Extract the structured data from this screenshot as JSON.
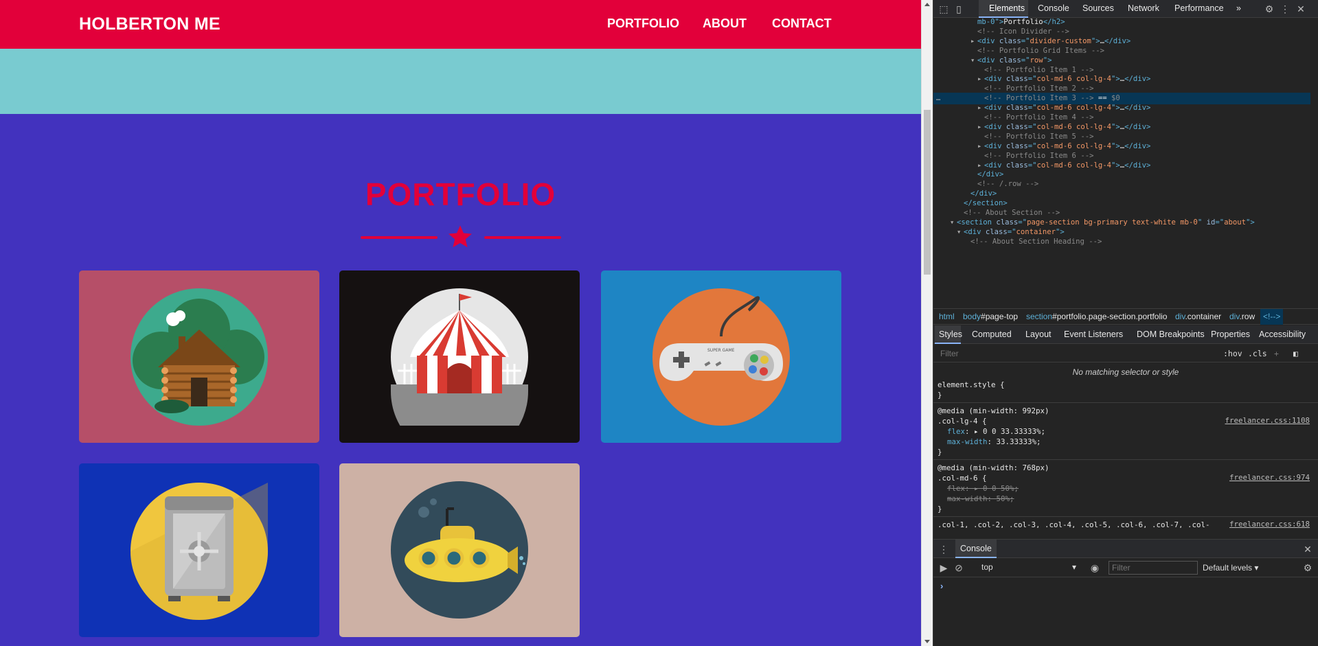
{
  "site": {
    "brand": "HOLBERTON ME",
    "nav": [
      "PORTFOLIO",
      "ABOUT",
      "CONTACT"
    ],
    "portfolio_heading": "PORTFOLIO",
    "colors": {
      "navbar": "#e2003a",
      "teal_band": "#79cbd0",
      "section_bg": "#4232be",
      "heading": "#e2003a"
    },
    "cards": [
      {
        "icon": "cabin-icon",
        "bg": "#b64f68"
      },
      {
        "icon": "circus-tent-icon",
        "bg": "#151111"
      },
      {
        "icon": "game-controller-icon",
        "bg": "#1e85c4"
      },
      {
        "icon": "safe-icon",
        "bg": "#0f32b5"
      },
      {
        "icon": "submarine-icon",
        "bg": "#cdb1a5"
      }
    ],
    "controller_label": "SUPER GAME"
  },
  "devtools": {
    "tabs": [
      "Elements",
      "Console",
      "Sources",
      "Network",
      "Performance"
    ],
    "more_tabs": "»",
    "dom_lines": [
      {
        "parts": [
          [
            "t",
            "mb-0\">"
          ],
          [
            "x",
            "Portfolio"
          ],
          [
            "t",
            "</h2>"
          ]
        ]
      },
      {
        "parts": [
          [
            "c",
            "<!-- Icon Divider -->"
          ]
        ]
      },
      {
        "parts": [
          [
            "t",
            "<div "
          ],
          [
            "a",
            "class"
          ],
          [
            "t",
            "=\""
          ],
          [
            "v",
            "divider-custom"
          ],
          [
            "t",
            "\">"
          ],
          [
            "x",
            "…"
          ],
          [
            "t",
            "</div>"
          ]
        ]
      },
      {
        "parts": [
          [
            "c",
            "<!-- Portfolio Grid Items -->"
          ]
        ]
      },
      {
        "parts": [
          [
            "t",
            "<div "
          ],
          [
            "a",
            "class"
          ],
          [
            "t",
            "=\""
          ],
          [
            "v",
            "row"
          ],
          [
            "t",
            "\">"
          ]
        ]
      },
      {
        "parts": [
          [
            "c",
            "<!-- Portfolio Item 1 -->"
          ]
        ]
      },
      {
        "parts": [
          [
            "t",
            "<div "
          ],
          [
            "a",
            "class"
          ],
          [
            "t",
            "=\""
          ],
          [
            "v",
            "col-md-6 col-lg-4"
          ],
          [
            "t",
            "\">"
          ],
          [
            "x",
            "…"
          ],
          [
            "t",
            "</div>"
          ]
        ]
      },
      {
        "parts": [
          [
            "c",
            "<!-- Portfolio Item 2 -->"
          ]
        ]
      },
      {
        "parts": [
          [
            "c",
            "<!-- Portfolio Item 3 -->"
          ],
          [
            "x",
            " == "
          ],
          [
            "c",
            "$0"
          ]
        ]
      },
      {
        "parts": [
          [
            "t",
            "<div "
          ],
          [
            "a",
            "class"
          ],
          [
            "t",
            "=\""
          ],
          [
            "v",
            "col-md-6 col-lg-4"
          ],
          [
            "t",
            "\">"
          ],
          [
            "x",
            "…"
          ],
          [
            "t",
            "</div>"
          ]
        ]
      },
      {
        "parts": [
          [
            "c",
            "<!-- Portfolio Item 4 -->"
          ]
        ]
      },
      {
        "parts": [
          [
            "t",
            "<div "
          ],
          [
            "a",
            "class"
          ],
          [
            "t",
            "=\""
          ],
          [
            "v",
            "col-md-6 col-lg-4"
          ],
          [
            "t",
            "\">"
          ],
          [
            "x",
            "…"
          ],
          [
            "t",
            "</div>"
          ]
        ]
      },
      {
        "parts": [
          [
            "c",
            "<!-- Portfolio Item 5 -->"
          ]
        ]
      },
      {
        "parts": [
          [
            "t",
            "<div "
          ],
          [
            "a",
            "class"
          ],
          [
            "t",
            "=\""
          ],
          [
            "v",
            "col-md-6 col-lg-4"
          ],
          [
            "t",
            "\">"
          ],
          [
            "x",
            "…"
          ],
          [
            "t",
            "</div>"
          ]
        ]
      },
      {
        "parts": [
          [
            "c",
            "<!-- Portfolio Item 6 -->"
          ]
        ]
      },
      {
        "parts": [
          [
            "t",
            "<div "
          ],
          [
            "a",
            "class"
          ],
          [
            "t",
            "=\""
          ],
          [
            "v",
            "col-md-6 col-lg-4"
          ],
          [
            "t",
            "\">"
          ],
          [
            "x",
            "…"
          ],
          [
            "t",
            "</div>"
          ]
        ]
      },
      {
        "parts": [
          [
            "t",
            "</div>"
          ]
        ]
      },
      {
        "parts": [
          [
            "c",
            "<!-- /.row -->"
          ]
        ]
      },
      {
        "parts": [
          [
            "t",
            "</div>"
          ]
        ]
      },
      {
        "parts": [
          [
            "t",
            "</section>"
          ]
        ]
      },
      {
        "parts": [
          [
            "c",
            "<!-- About Section -->"
          ]
        ]
      },
      {
        "parts": [
          [
            "t",
            "<section "
          ],
          [
            "a",
            "class"
          ],
          [
            "t",
            "=\""
          ],
          [
            "v",
            "page-section bg-primary text-white mb-0"
          ],
          [
            "t",
            "\" "
          ],
          [
            "a",
            "id"
          ],
          [
            "t",
            "=\""
          ],
          [
            "v",
            "about"
          ],
          [
            "t",
            "\">"
          ]
        ]
      },
      {
        "parts": [
          [
            "t",
            "<div "
          ],
          [
            "a",
            "class"
          ],
          [
            "t",
            "=\""
          ],
          [
            "v",
            "container"
          ],
          [
            "t",
            "\">"
          ]
        ]
      },
      {
        "parts": [
          [
            "c",
            "<!-- About Section Heading -->"
          ]
        ]
      }
    ],
    "dom_expand": [
      null,
      null,
      "right",
      null,
      "down",
      null,
      "right",
      null,
      null,
      "right",
      null,
      "right",
      null,
      "right",
      null,
      "right",
      null,
      null,
      null,
      null,
      null,
      "down",
      "down",
      null
    ],
    "dom_selected_dots": "…",
    "breadcrumbs": [
      {
        "tag": "html",
        "id": ""
      },
      {
        "tag": "body",
        "id": "#page-top"
      },
      {
        "tag": "section",
        "id": "#portfolio.page-section.portfolio"
      },
      {
        "tag": "div",
        "id": ".container"
      },
      {
        "tag": "div",
        "id": ".row"
      },
      {
        "tag": "<!-->",
        "id": ""
      }
    ],
    "styles_tabs": [
      "Styles",
      "Computed",
      "Layout",
      "Event Listeners",
      "DOM Breakpoints",
      "Properties",
      "Accessibility"
    ],
    "filter_placeholder": "Filter",
    "hov": ":hov",
    "cls": ".cls",
    "no_match": "No matching selector or style",
    "styles_rules": {
      "element_style_open": "element.style {",
      "close": "}",
      "media1": "@media (min-width: 992px)",
      "sel1": ".col-lg-4 {",
      "link1": "freelancer.css:1108",
      "p1a_name": "flex",
      "p1a_val": ": ▸ 0 0 33.33333%;",
      "p1b_name": "max-width",
      "p1b_val": ": 33.33333%;",
      "media2": "@media (min-width: 768px)",
      "sel2": ".col-md-6 {",
      "link2": "freelancer.css:974",
      "p2a": "flex: ▸ 0 0 50%;",
      "p2b": "max-width: 50%;",
      "sel3": ".col-1, .col-2, .col-3, .col-4, .col-5, .col-6, .col-7, .col-",
      "link3": "freelancer.css:618"
    },
    "console": {
      "tab": "Console",
      "context": "top",
      "filter_placeholder": "Filter",
      "levels": "Default levels ▾",
      "prompt": "›"
    }
  }
}
